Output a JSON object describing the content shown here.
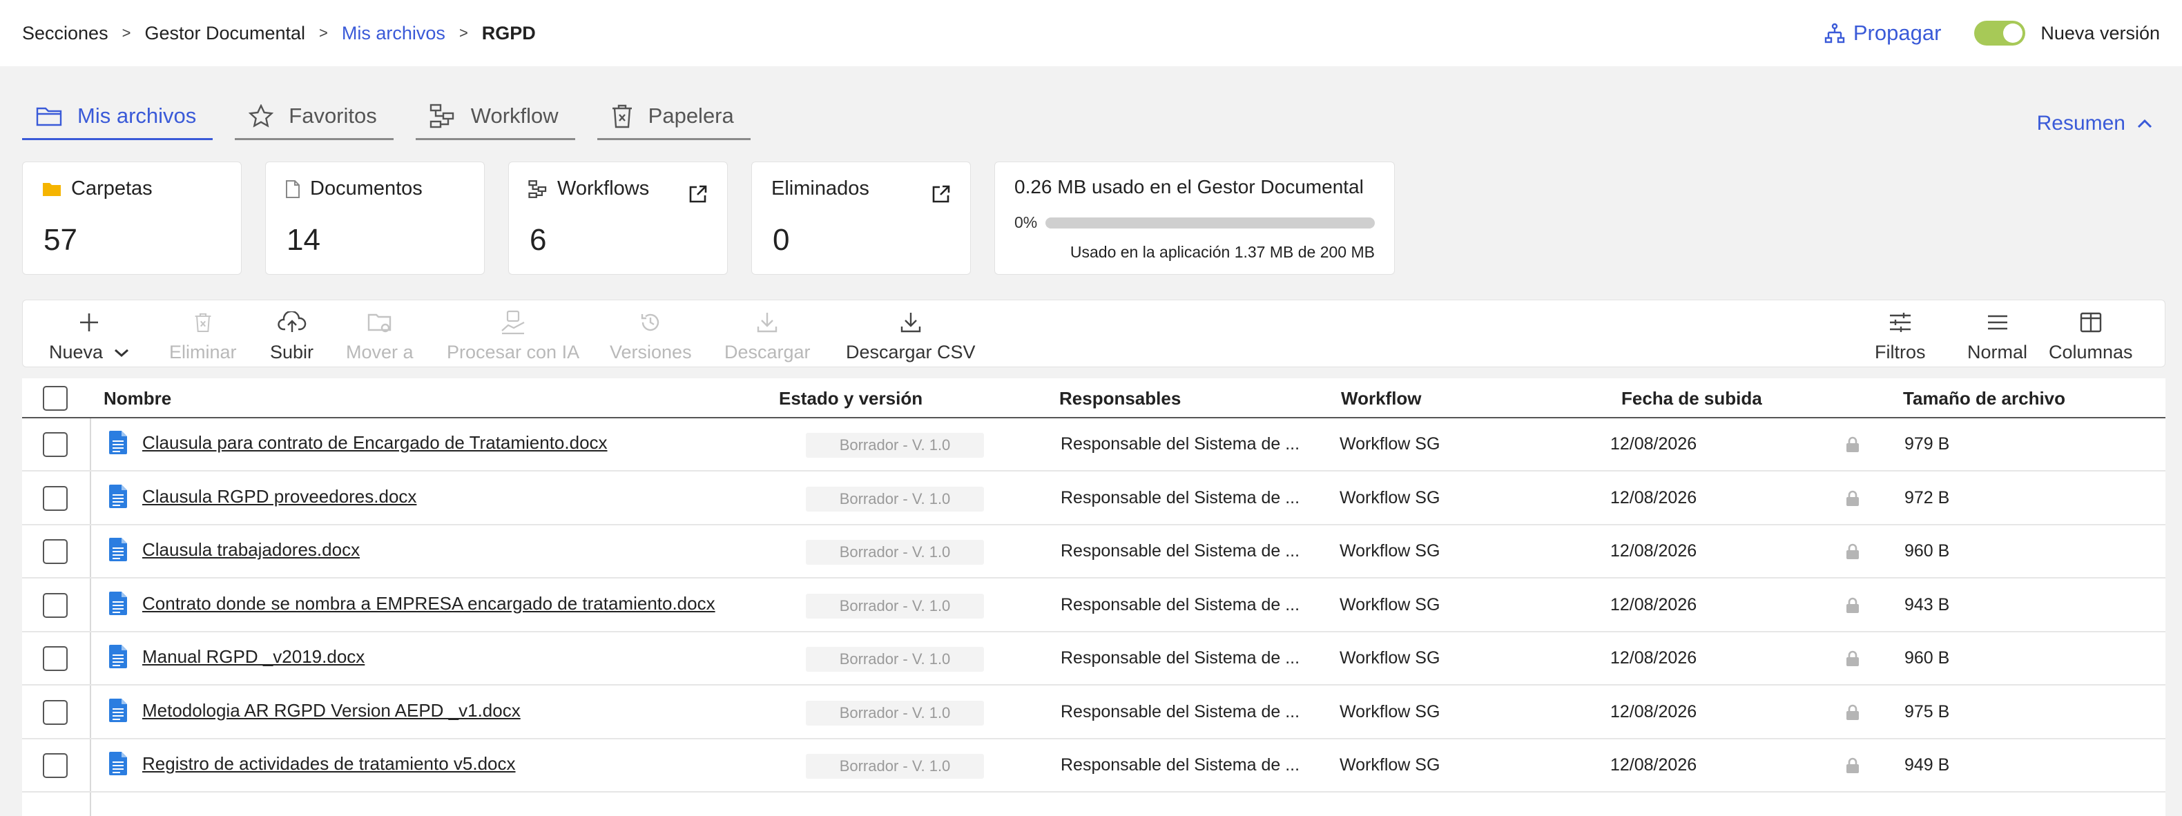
{
  "breadcrumb": {
    "items": [
      "Secciones",
      "Gestor Documental",
      "Mis archivos",
      "RGPD"
    ]
  },
  "header": {
    "propagar_label": "Propagar",
    "toggle_label": "Nueva versión",
    "toggle_on": true
  },
  "tabs": [
    {
      "label": "Mis archivos",
      "icon": "folder-icon",
      "active": true
    },
    {
      "label": "Favoritos",
      "icon": "star-icon",
      "active": false
    },
    {
      "label": "Workflow",
      "icon": "workflow-icon",
      "active": false
    },
    {
      "label": "Papelera",
      "icon": "trash-icon",
      "active": false
    }
  ],
  "resumen_label": "Resumen",
  "cards": [
    {
      "label": "Carpetas",
      "value": "57",
      "icon": "folder-icon"
    },
    {
      "label": "Documentos",
      "value": "14",
      "icon": "document-icon"
    },
    {
      "label": "Workflows",
      "value": "6",
      "icon": "workflow-icon",
      "external": true
    },
    {
      "label": "Eliminados",
      "value": "0",
      "external": true
    }
  ],
  "storage": {
    "title": "0.26 MB usado en el Gestor Documental",
    "percent_label": "0%",
    "percent": 0,
    "footer": "Usado en la aplicación 1.37 MB de 200 MB"
  },
  "toolbar": {
    "nueva": "Nueva",
    "eliminar": "Eliminar",
    "subir": "Subir",
    "mover": "Mover a",
    "procesar": "Procesar con IA",
    "versiones": "Versiones",
    "descargar": "Descargar",
    "descargar_csv": "Descargar CSV",
    "filtros": "Filtros",
    "normal": "Normal",
    "columnas": "Columnas"
  },
  "table": {
    "columns": [
      "Nombre",
      "Estado y versión",
      "Responsables",
      "Workflow",
      "Fecha de subida",
      "Tamaño de archivo"
    ],
    "rows": [
      {
        "name": "Clausula para contrato de Encargado de Tratamiento.docx",
        "status": "Borrador - V. 1.0",
        "responsable": "Responsable del Sistema de ...",
        "workflow": "Workflow SG",
        "fecha": "12/08/2026",
        "size": "979 B"
      },
      {
        "name": "Clausula RGPD proveedores.docx",
        "status": "Borrador - V. 1.0",
        "responsable": "Responsable del Sistema de ...",
        "workflow": "Workflow SG",
        "fecha": "12/08/2026",
        "size": "972 B"
      },
      {
        "name": "Clausula trabajadores.docx",
        "status": "Borrador - V. 1.0",
        "responsable": "Responsable del Sistema de ...",
        "workflow": "Workflow SG",
        "fecha": "12/08/2026",
        "size": "960 B"
      },
      {
        "name": "Contrato donde se nombra a EMPRESA encargado de tratamiento.docx",
        "status": "Borrador - V. 1.0",
        "responsable": "Responsable del Sistema de ...",
        "workflow": "Workflow SG",
        "fecha": "12/08/2026",
        "size": "943 B"
      },
      {
        "name": "Manual RGPD _v2019.docx",
        "status": "Borrador - V. 1.0",
        "responsable": "Responsable del Sistema de ...",
        "workflow": "Workflow SG",
        "fecha": "12/08/2026",
        "size": "960 B"
      },
      {
        "name": "Metodologia AR RGPD Version AEPD _v1.docx",
        "status": "Borrador - V. 1.0",
        "responsable": "Responsable del Sistema de ...",
        "workflow": "Workflow SG",
        "fecha": "12/08/2026",
        "size": "975 B"
      },
      {
        "name": "Registro de actividades de tratamiento v5.docx",
        "status": "Borrador - V. 1.0",
        "responsable": "Responsable del Sistema de ...",
        "workflow": "Workflow SG",
        "fecha": "12/08/2026",
        "size": "949 B"
      }
    ]
  },
  "colors": {
    "accent": "#3a5ad8",
    "toggle": "#a7c957",
    "folder": "#f5b400",
    "doc": "#2b7de0"
  }
}
